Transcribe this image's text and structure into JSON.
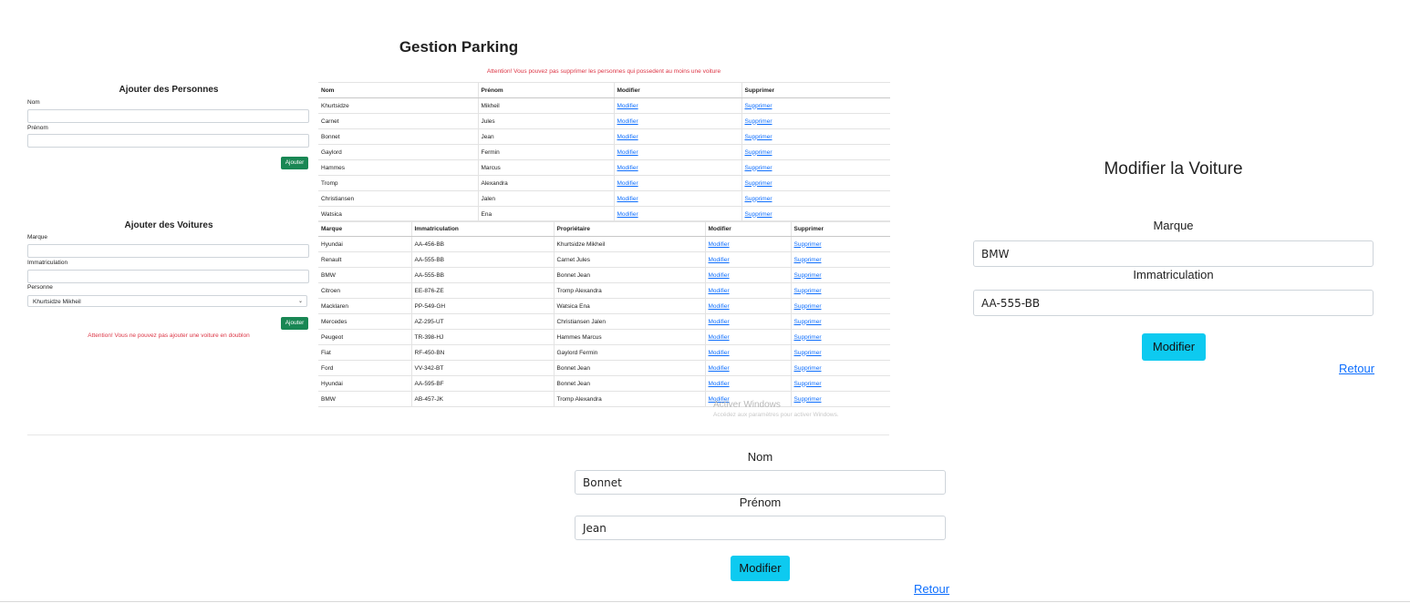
{
  "header": {
    "title": "Gestion Parking"
  },
  "warnings": {
    "delete_person": "Attention! Vous pouvez pas supprimer les personnes qui possedent au moins une voiture",
    "duplicate_car": "Attention! Vous ne pouvez pas ajouter une voiture en doublon"
  },
  "person_form": {
    "title": "Ajouter des Personnes",
    "nom_label": "Nom",
    "prenom_label": "Prénom",
    "submit_label": "Ajouter"
  },
  "car_form": {
    "title": "Ajouter des Voitures",
    "marque_label": "Marque",
    "immat_label": "Immatriculation",
    "personne_label": "Personne",
    "personne_selected": "Khurtsidze Mikheil",
    "submit_label": "Ajouter"
  },
  "persons_table": {
    "headers": [
      "Nom",
      "Prénom",
      "Modifier",
      "Supprimer"
    ],
    "rows": [
      [
        "Khurtsidze",
        "Mikheil",
        "Modifier",
        "Supprimer"
      ],
      [
        "Carnet",
        "Jules",
        "Modifier",
        "Supprimer"
      ],
      [
        "Bonnet",
        "Jean",
        "Modifier",
        "Supprimer"
      ],
      [
        "Gaylord",
        "Fermin",
        "Modifier",
        "Supprimer"
      ],
      [
        "Hammes",
        "Marcus",
        "Modifier",
        "Supprimer"
      ],
      [
        "Tromp",
        "Alexandra",
        "Modifier",
        "Supprimer"
      ],
      [
        "Christiansen",
        "Jalen",
        "Modifier",
        "Supprimer"
      ],
      [
        "Watsica",
        "Ena",
        "Modifier",
        "Supprimer"
      ]
    ]
  },
  "cars_table": {
    "headers": [
      "Marque",
      "Immatriculation",
      "Propriétaire",
      "Modifier",
      "Supprimer"
    ],
    "rows": [
      [
        "Hyundai",
        "AA-456-BB",
        "Khurtsidze Mikheil",
        "Modifier",
        "Supprimer"
      ],
      [
        "Renault",
        "AA-555-BB",
        "Carnet Jules",
        "Modifier",
        "Supprimer"
      ],
      [
        "BMW",
        "AA-555-BB",
        "Bonnet Jean",
        "Modifier",
        "Supprimer"
      ],
      [
        "Citroen",
        "EE-876-ZE",
        "Tromp Alexandra",
        "Modifier",
        "Supprimer"
      ],
      [
        "Macklaren",
        "PP-549-GH",
        "Watsica Ena",
        "Modifier",
        "Supprimer"
      ],
      [
        "Mercedes",
        "AZ-295-UT",
        "Christiansen Jalen",
        "Modifier",
        "Supprimer"
      ],
      [
        "Peugeot",
        "TR-398-HJ",
        "Hammes Marcus",
        "Modifier",
        "Supprimer"
      ],
      [
        "Fiat",
        "RF-450-BN",
        "Gaylord Fermin",
        "Modifier",
        "Supprimer"
      ],
      [
        "Ford",
        "VV-342-BT",
        "Bonnet Jean",
        "Modifier",
        "Supprimer"
      ],
      [
        "Hyundai",
        "AA-595-BF",
        "Bonnet Jean",
        "Modifier",
        "Supprimer"
      ],
      [
        "BMW",
        "AB-457-JK",
        "Tromp Alexandra",
        "Modifier",
        "Supprimer"
      ]
    ]
  },
  "watermark": {
    "title": "Activer Windows",
    "subtitle": "Accédez aux paramètres pour activer Windows."
  },
  "edit_person": {
    "nom_label": "Nom",
    "nom_value": "Bonnet",
    "prenom_label": "Prénom",
    "prenom_value": "Jean",
    "submit_label": "Modifier",
    "back_label": "Retour"
  },
  "edit_car": {
    "title": "Modifier la Voiture",
    "marque_label": "Marque",
    "marque_value": "BMW",
    "immat_label": "Immatriculation",
    "immat_value": "AA-555-BB",
    "submit_label": "Modifier",
    "back_label": "Retour"
  },
  "colors": {
    "danger": "#dc3545",
    "success": "#198754",
    "info": "#0dcaf0",
    "link": "#0d6efd"
  }
}
